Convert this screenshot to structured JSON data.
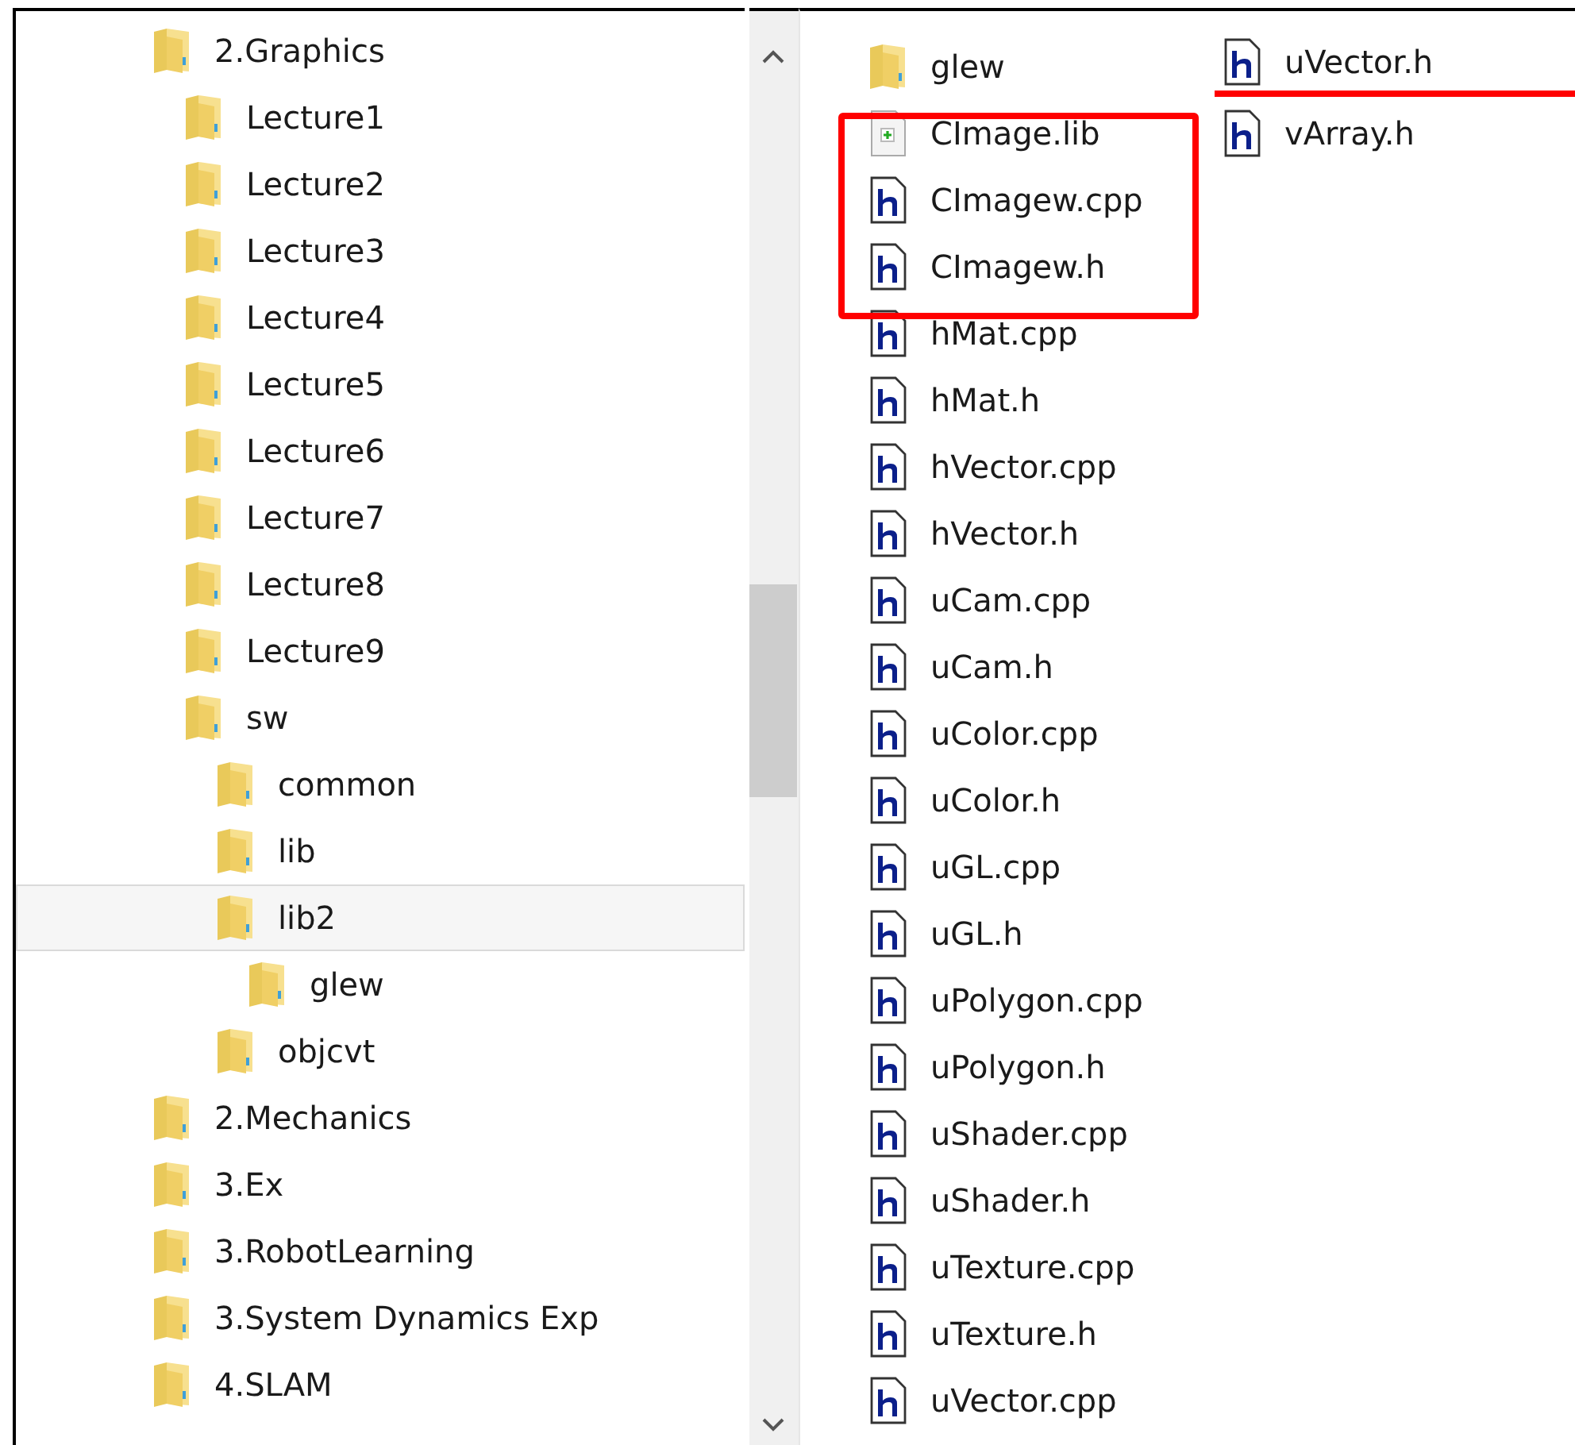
{
  "tree": [
    {
      "label": "2.Graphics",
      "selected": false,
      "children": [
        {
          "label": "Lecture1",
          "selected": false
        },
        {
          "label": "Lecture2",
          "selected": false
        },
        {
          "label": "Lecture3",
          "selected": false
        },
        {
          "label": "Lecture4",
          "selected": false
        },
        {
          "label": "Lecture5",
          "selected": false
        },
        {
          "label": "Lecture6",
          "selected": false
        },
        {
          "label": "Lecture7",
          "selected": false
        },
        {
          "label": "Lecture8",
          "selected": false
        },
        {
          "label": "Lecture9",
          "selected": false
        },
        {
          "label": "sw",
          "selected": false,
          "children": [
            {
              "label": "common",
              "selected": false
            },
            {
              "label": "lib",
              "selected": false
            },
            {
              "label": "lib2",
              "selected": true,
              "children": [
                {
                  "label": "glew",
                  "selected": false
                }
              ]
            },
            {
              "label": "objcvt",
              "selected": false
            }
          ]
        }
      ]
    },
    {
      "label": "2.Mechanics",
      "selected": false
    },
    {
      "label": "3.Ex",
      "selected": false
    },
    {
      "label": "3.RobotLearning",
      "selected": false
    },
    {
      "label": "3.System Dynamics Exp",
      "selected": false
    },
    {
      "label": "4.SLAM",
      "selected": false
    }
  ],
  "files": [
    {
      "name": "glew",
      "kind": "folder",
      "boxed": false,
      "underlined": false
    },
    {
      "name": "CImage.lib",
      "kind": "lib",
      "boxed": true,
      "underlined": false
    },
    {
      "name": "CImagew.cpp",
      "kind": "header",
      "boxed": true,
      "underlined": false
    },
    {
      "name": "CImagew.h",
      "kind": "header",
      "boxed": true,
      "underlined": false
    },
    {
      "name": "hMat.cpp",
      "kind": "header",
      "boxed": false,
      "underlined": false
    },
    {
      "name": "hMat.h",
      "kind": "header",
      "boxed": false,
      "underlined": false
    },
    {
      "name": "hVector.cpp",
      "kind": "header",
      "boxed": false,
      "underlined": false
    },
    {
      "name": "hVector.h",
      "kind": "header",
      "boxed": false,
      "underlined": false
    },
    {
      "name": "uCam.cpp",
      "kind": "header",
      "boxed": false,
      "underlined": false
    },
    {
      "name": "uCam.h",
      "kind": "header",
      "boxed": false,
      "underlined": false
    },
    {
      "name": "uColor.cpp",
      "kind": "header",
      "boxed": false,
      "underlined": false
    },
    {
      "name": "uColor.h",
      "kind": "header",
      "boxed": false,
      "underlined": false
    },
    {
      "name": "uGL.cpp",
      "kind": "header",
      "boxed": false,
      "underlined": false
    },
    {
      "name": "uGL.h",
      "kind": "header",
      "boxed": false,
      "underlined": false
    },
    {
      "name": "uPolygon.cpp",
      "kind": "header",
      "boxed": false,
      "underlined": false
    },
    {
      "name": "uPolygon.h",
      "kind": "header",
      "boxed": false,
      "underlined": false
    },
    {
      "name": "uShader.cpp",
      "kind": "header",
      "boxed": false,
      "underlined": false
    },
    {
      "name": "uShader.h",
      "kind": "header",
      "boxed": false,
      "underlined": false
    },
    {
      "name": "uTexture.cpp",
      "kind": "header",
      "boxed": false,
      "underlined": false
    },
    {
      "name": "uTexture.h",
      "kind": "header",
      "boxed": false,
      "underlined": false
    },
    {
      "name": "uVector.cpp",
      "kind": "header",
      "boxed": false,
      "underlined": false
    },
    {
      "name": "uVector.h",
      "kind": "header",
      "boxed": false,
      "underlined": true
    },
    {
      "name": "vArray.h",
      "kind": "header",
      "boxed": false,
      "underlined": false
    }
  ]
}
